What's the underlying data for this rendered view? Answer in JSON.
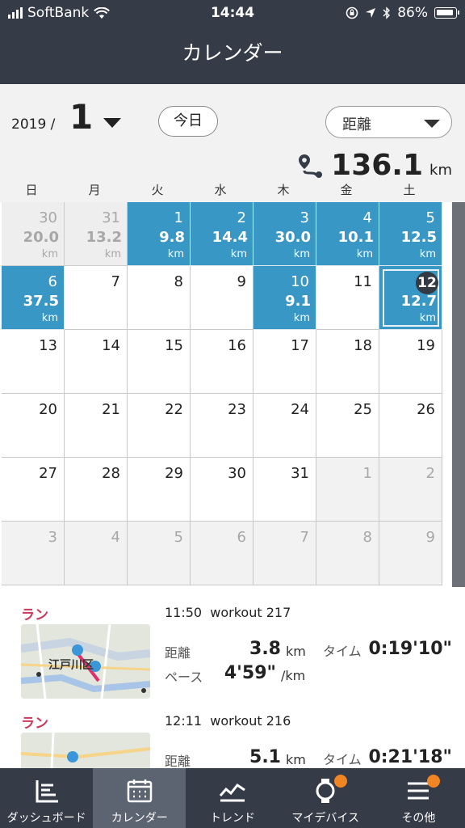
{
  "status_bar": {
    "carrier": "SoftBank",
    "time": "14:44",
    "battery": "86%"
  },
  "header": {
    "title": "カレンダー"
  },
  "controls": {
    "year": "2019 /",
    "month": "1",
    "today_label": "今日",
    "metric_label": "距離",
    "total_value": "136.1",
    "total_unit": "km"
  },
  "weekdays": [
    "日",
    "月",
    "火",
    "水",
    "木",
    "金",
    "土"
  ],
  "calendar": {
    "unit": "km",
    "days": [
      {
        "day": "30",
        "dist": "20.0",
        "out": true
      },
      {
        "day": "31",
        "dist": "13.2",
        "out": true
      },
      {
        "day": "1",
        "dist": "9.8"
      },
      {
        "day": "2",
        "dist": "14.4"
      },
      {
        "day": "3",
        "dist": "30.0"
      },
      {
        "day": "4",
        "dist": "10.1"
      },
      {
        "day": "5",
        "dist": "12.5"
      },
      {
        "day": "6",
        "dist": "37.5"
      },
      {
        "day": "7"
      },
      {
        "day": "8"
      },
      {
        "day": "9"
      },
      {
        "day": "10",
        "dist": "9.1"
      },
      {
        "day": "11"
      },
      {
        "day": "12",
        "dist": "12.7",
        "today": true
      },
      {
        "day": "13"
      },
      {
        "day": "14"
      },
      {
        "day": "15"
      },
      {
        "day": "16"
      },
      {
        "day": "17"
      },
      {
        "day": "18"
      },
      {
        "day": "19"
      },
      {
        "day": "20"
      },
      {
        "day": "21"
      },
      {
        "day": "22"
      },
      {
        "day": "23"
      },
      {
        "day": "24"
      },
      {
        "day": "25"
      },
      {
        "day": "26"
      },
      {
        "day": "27"
      },
      {
        "day": "28"
      },
      {
        "day": "29"
      },
      {
        "day": "30"
      },
      {
        "day": "31"
      },
      {
        "day": "1",
        "out": true
      },
      {
        "day": "2",
        "out": true
      },
      {
        "day": "3",
        "out": true
      },
      {
        "day": "4",
        "out": true
      },
      {
        "day": "5",
        "out": true
      },
      {
        "day": "6",
        "out": true
      },
      {
        "day": "7",
        "out": true
      },
      {
        "day": "8",
        "out": true
      },
      {
        "day": "9",
        "out": true
      }
    ]
  },
  "workouts": [
    {
      "type": "ラン",
      "time": "11:50",
      "name": "workout 217",
      "distance_label": "距離",
      "distance": "3.8",
      "distance_unit": "km",
      "time_label": "タイム",
      "duration": "0:19'10\"",
      "pace_label": "ペース",
      "pace": "4'59\"",
      "pace_unit": "/km",
      "map_label": "江戸川区"
    },
    {
      "type": "ラン",
      "time": "12:11",
      "name": "workout 216",
      "distance_label": "距離",
      "distance": "5.1",
      "distance_unit": "km",
      "time_label": "タイム",
      "duration": "0:21'18\""
    }
  ],
  "tabs": [
    {
      "label": "ダッシュボード",
      "icon": "dashboard-icon"
    },
    {
      "label": "カレンダー",
      "icon": "calendar-icon",
      "selected": true
    },
    {
      "label": "トレンド",
      "icon": "trend-icon"
    },
    {
      "label": "マイデバイス",
      "icon": "watch-icon",
      "badge": true
    },
    {
      "label": "その他",
      "icon": "menu-icon",
      "badge": true
    }
  ],
  "colors": {
    "header_bg": "#353b47",
    "active_day": "#3897c4",
    "run_label": "#c93a5c",
    "badge": "#f08524"
  }
}
